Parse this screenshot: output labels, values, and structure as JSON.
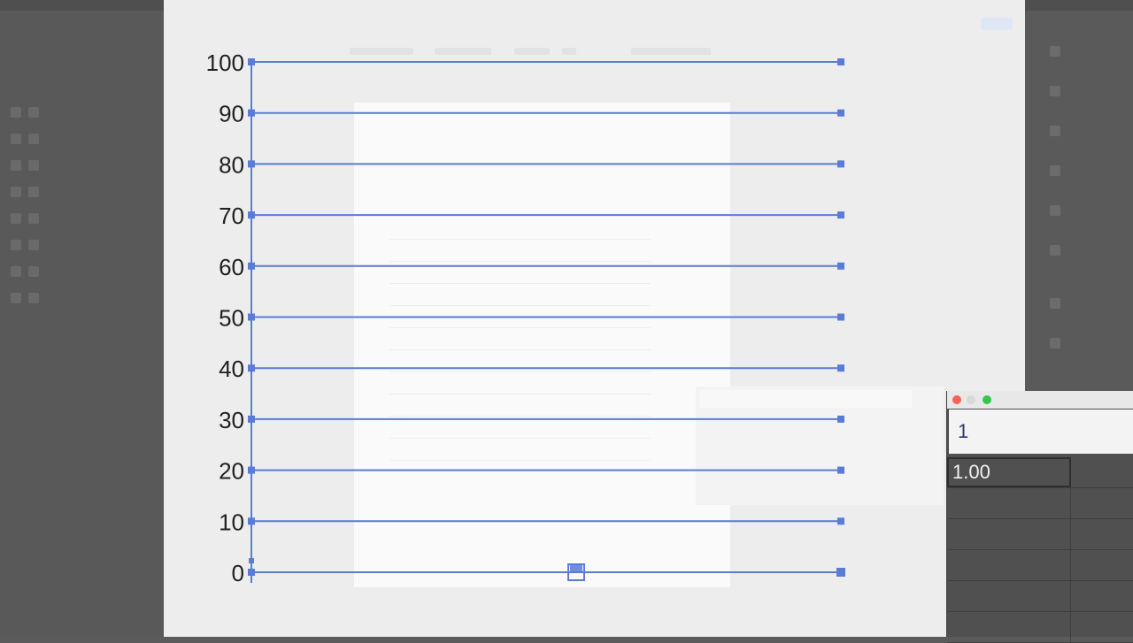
{
  "data_entry": {
    "value": "1"
  },
  "data_grid": {
    "rows": [
      [
        "1.00",
        ""
      ],
      [
        "",
        ""
      ],
      [
        "",
        ""
      ],
      [
        "",
        ""
      ],
      [
        "",
        ""
      ],
      [
        "",
        ""
      ]
    ]
  },
  "chart_data": {
    "type": "bar",
    "categories": [
      ""
    ],
    "values": [
      1
    ],
    "ylim": [
      0,
      100
    ],
    "yticks": [
      "0",
      "10",
      "20",
      "30",
      "40",
      "50",
      "60",
      "70",
      "80",
      "90",
      "100"
    ],
    "grid": true
  },
  "colors": {
    "selection_blue": "#5a7bd6",
    "label_text": "#1f1f1f",
    "background_chrome": "#5b5b5b",
    "overlay": "#ededee",
    "artboard": "#fafafa",
    "close_red": "#fc5f57",
    "zoom_green": "#35c64a"
  },
  "icons": {
    "close": "close-icon",
    "minimize": "minimize-icon",
    "zoom": "zoom-icon"
  }
}
